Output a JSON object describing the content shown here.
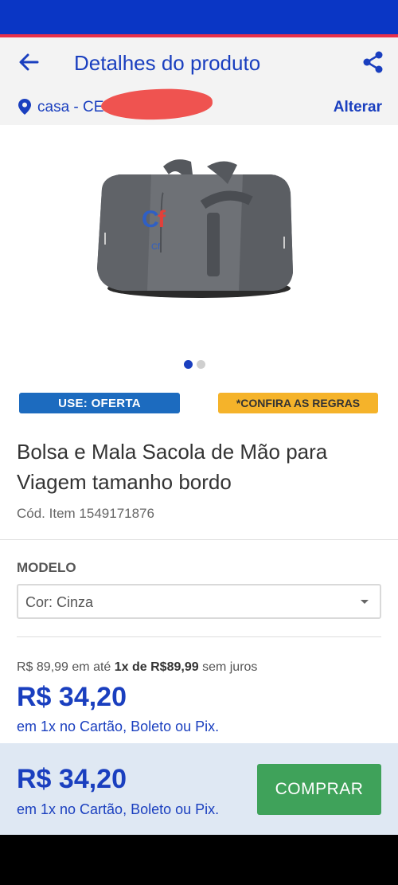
{
  "header": {
    "title": "Detalhes do produto",
    "back_icon": "arrow-left-icon",
    "share_icon": "share-icon"
  },
  "location": {
    "text": "casa - CE",
    "action_label": "Alterar",
    "icon": "location-pin-icon"
  },
  "gallery": {
    "total_images": 2,
    "active_index": 0
  },
  "badges": {
    "offer_label": "USE: OFERTA",
    "rules_label": "*CONFIRA AS REGRAS"
  },
  "product": {
    "title": "Bolsa e Mala Sacola de Mão para Viagem tamanho bordo",
    "code": "Cód. Item 1549171876"
  },
  "variant": {
    "label": "MODELO",
    "selected": "Cor: Cinza"
  },
  "pricing": {
    "old_price": "R$ 89,99",
    "installment_prefix": "em até",
    "installment": "1x de R$89,99",
    "installment_suffix": "sem juros",
    "price": "R$ 34,20",
    "payment_note": "em 1x no Cartão, Boleto ou Pix."
  },
  "footer": {
    "price": "R$ 34,20",
    "payment_note": "em 1x no Cartão, Boleto ou Pix.",
    "buy_label": "COMPRAR"
  },
  "colors": {
    "brand_blue": "#1a3fbf",
    "status_bar": "#0a36c5",
    "accent_red": "#e8304a",
    "offer_badge": "#1c6bbf",
    "rules_badge": "#f5b32a",
    "buy_green": "#3fa25a"
  }
}
